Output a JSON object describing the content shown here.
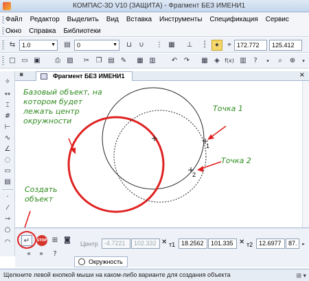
{
  "window": {
    "title": "КОМПАС-3D V10 (ЗАЩИТА) - Фрагмент БЕЗ ИМЕНИ1"
  },
  "menu": {
    "row1": [
      "Файл",
      "Редактор",
      "Выделить",
      "Вид",
      "Вставка",
      "Инструменты",
      "Спецификация",
      "Сервис"
    ],
    "row2": [
      "Окно",
      "Справка",
      "Библиотеки"
    ]
  },
  "toolbar1": {
    "line_style": "1.0",
    "layer": "0",
    "coord_x": "172.772",
    "coord_y": "125.412"
  },
  "document": {
    "tab_title": "Фрагмент БЕЗ ИМЕНИ1"
  },
  "canvas": {
    "note_base": "Базовый объект, на котором будет лежать центр окружности",
    "note_point1": "Точка 1",
    "note_point2": "Точка 2",
    "note_create": "Создать объект",
    "label_p1": "1",
    "label_p2": "2",
    "color_accent": "#e02020",
    "color_note": "#2e8a1e"
  },
  "properties": {
    "center_label": "Центр",
    "center_x": "-4.7221",
    "center_y": "102.332",
    "t1_label": "т1",
    "t1_x": "18.2562",
    "t1_y": "101.335",
    "t2_label": "т2",
    "t2_x": "12.6977",
    "t2_y": "87.",
    "tab_label": "Окружность"
  },
  "status": {
    "text": "Щелкните левой кнопкой мыши на каком-либо варианте для создания объекта"
  }
}
